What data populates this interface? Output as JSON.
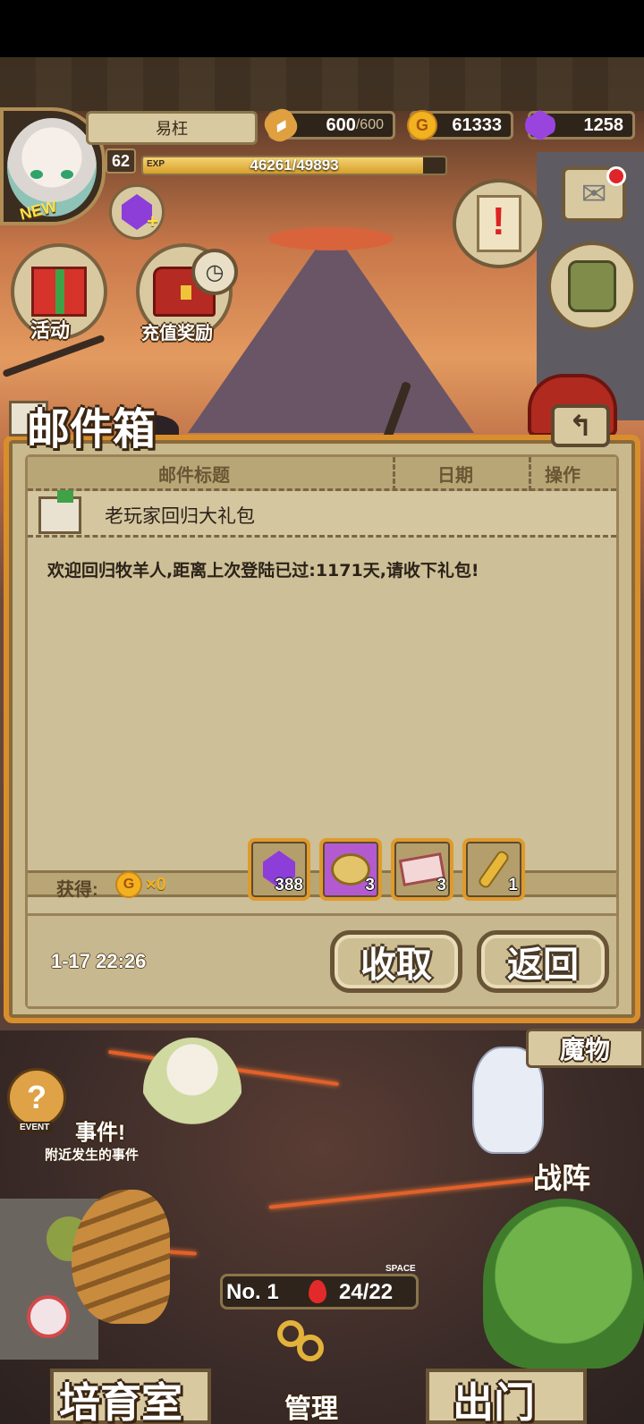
{
  "hud": {
    "player_name": "易枉",
    "new_badge": "NEW",
    "level": "62",
    "exp_tag": "EXP",
    "exp_text": "46261/49893",
    "exp_fraction": 0.927,
    "bread_current": "600",
    "bread_max": "/600",
    "gold": "61333",
    "gems": "1258",
    "gold_icon": "G"
  },
  "side_buttons": {
    "activity_label": "活动",
    "recharge_label": "充值奖励"
  },
  "mailbox": {
    "title": "邮件箱",
    "columns": [
      "邮件标题",
      "日期",
      "操作"
    ],
    "subject": "老玩家回归大礼包",
    "body": "欢迎回归牧羊人,距离上次登陆已过:1171天,请收下礼包!",
    "obtain_label": "获得:",
    "obtain_gold": "×0",
    "attachments": [
      {
        "name": "gem",
        "count": "388"
      },
      {
        "name": "gold-bag",
        "count": "3"
      },
      {
        "name": "ticket",
        "count": "3"
      },
      {
        "name": "key",
        "count": "1"
      }
    ],
    "timestamp": "1-17 22:26",
    "collect_label": "收取",
    "return_label": "返回",
    "back_icon": "↰"
  },
  "bottom": {
    "event_tag": "EVENT",
    "event_title": "事件!",
    "event_subtitle": "附近发生的事件",
    "monster_label": "魔物",
    "formation_label": "战阵",
    "rank": "No. 1",
    "space_tag": "SPACE",
    "space_count": "24/22",
    "nursery_label": "培育室",
    "manage_label": "管理",
    "exit_label": "出门"
  },
  "colors": {
    "panel_border": "#d98e2c",
    "parchment": "#cdbf97",
    "gold": "#f2b21f",
    "gem_purple": "#8d3ed8",
    "notification_red": "#e0252a"
  }
}
